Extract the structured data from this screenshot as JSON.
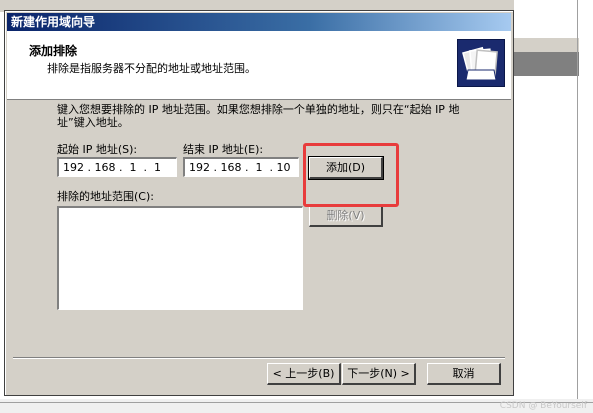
{
  "wizard": {
    "title": "新建作用域向导",
    "header": {
      "title": "添加排除",
      "subtitle": "排除是指服务器不分配的地址或地址范围。",
      "icon": "folders-icon"
    },
    "intro": "键入您想要排除的 IP 地址范围。如果您想排除一个单独的地址，则只在“起始 IP 地址”键入地址。",
    "start_ip": {
      "label": "起始 IP 地址(S):",
      "value": "192 . 168 .  1  .  1"
    },
    "end_ip": {
      "label": "结束 IP 地址(E):",
      "value": "192 . 168 .  1  . 10"
    },
    "add_button": "添加(D)",
    "remove_button": "删除(V)",
    "excluded_label": "排除的地址范围(C):",
    "excluded_items": [],
    "back_button": "< 上一步(B)",
    "next_button": "下一步(N) >",
    "cancel_button": "取消"
  },
  "watermark": "CSDN @ BeYourself",
  "colors": {
    "titlebar": "#0a246a",
    "dialog_bg": "#d4d0c8",
    "highlight": "#e83c3c"
  }
}
